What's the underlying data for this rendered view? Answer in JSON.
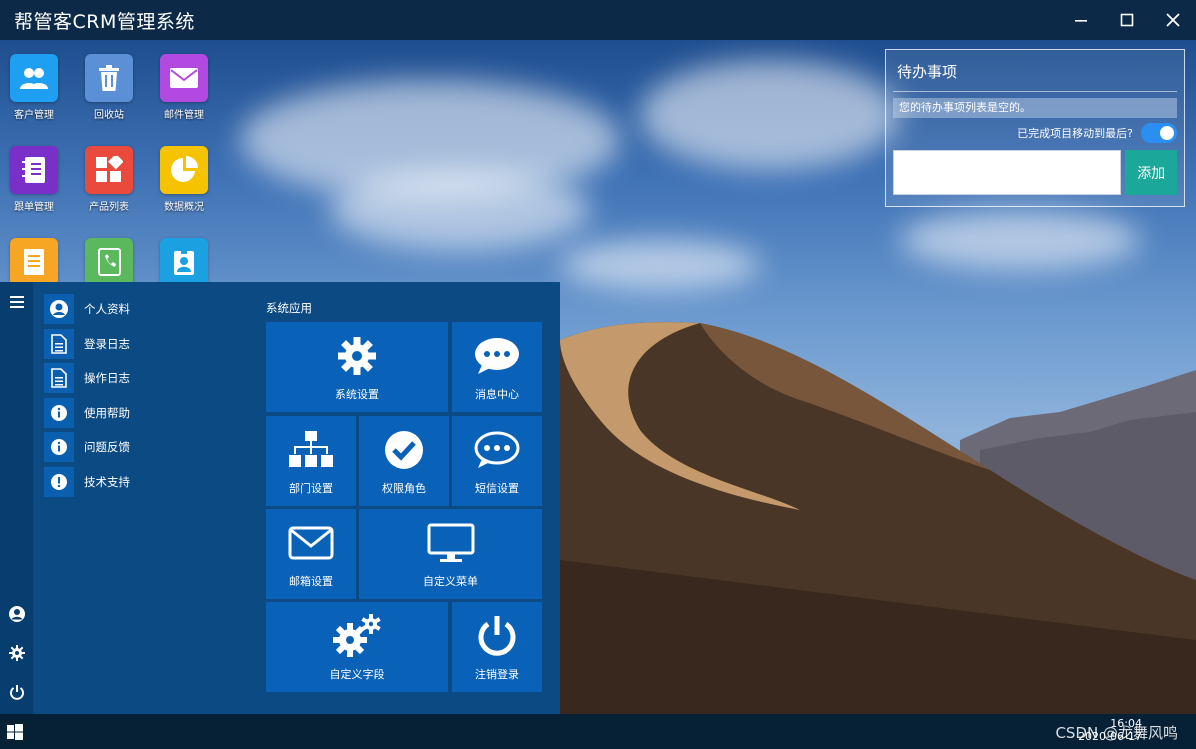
{
  "window": {
    "title": "帮管客CRM管理系统"
  },
  "desktop_icons": [
    {
      "label": "客户管理",
      "icon": "users-icon",
      "color": "#1e9ff2"
    },
    {
      "label": "回收站",
      "icon": "trash-icon",
      "color": "#5b8fd6"
    },
    {
      "label": "邮件管理",
      "icon": "mail-icon",
      "color": "#b249e0"
    },
    {
      "label": "跟单管理",
      "icon": "notebook-icon",
      "color": "#7a2fc8"
    },
    {
      "label": "产品列表",
      "icon": "grid-icon",
      "color": "#e94a3b"
    },
    {
      "label": "数据概况",
      "icon": "pie-icon",
      "color": "#f5c300"
    },
    {
      "label": "",
      "icon": "document-icon",
      "color": "#f6a623"
    },
    {
      "label": "",
      "icon": "contacts-book-icon",
      "color": "#5cb85c"
    },
    {
      "label": "",
      "icon": "id-badge-icon",
      "color": "#1ba1e2"
    }
  ],
  "todo": {
    "title": "待办事项",
    "empty_text": "您的待办事项列表是空的。",
    "toggle_label": "已完成项目移动到最后?",
    "toggle_on": true,
    "input_value": "",
    "add_label": "添加"
  },
  "start_menu": {
    "list": [
      {
        "label": "个人资料",
        "icon": "user-circle-icon"
      },
      {
        "label": "登录日志",
        "icon": "file-icon"
      },
      {
        "label": "操作日志",
        "icon": "file-icon"
      },
      {
        "label": "使用帮助",
        "icon": "info-icon"
      },
      {
        "label": "问题反馈",
        "icon": "info-icon"
      },
      {
        "label": "技术支持",
        "icon": "exclamation-icon"
      }
    ],
    "section_title": "系统应用",
    "tiles": [
      {
        "label": "系统设置",
        "icon": "gear-icon"
      },
      {
        "label": "消息中心",
        "icon": "chat-bubble-icon"
      },
      {
        "label": "部门设置",
        "icon": "sitemap-icon"
      },
      {
        "label": "权限角色",
        "icon": "check-circle-icon"
      },
      {
        "label": "短信设置",
        "icon": "chat-bubble-icon"
      },
      {
        "label": "邮箱设置",
        "icon": "envelope-icon"
      },
      {
        "label": "自定义菜单",
        "icon": "monitor-icon"
      },
      {
        "label": "自定义字段",
        "icon": "gears-icon"
      },
      {
        "label": "注销登录",
        "icon": "power-icon"
      }
    ]
  },
  "taskbar": {
    "time": "16:04",
    "date": "2020-06-17",
    "watermark": "CSDN @龙舞风鸣"
  }
}
